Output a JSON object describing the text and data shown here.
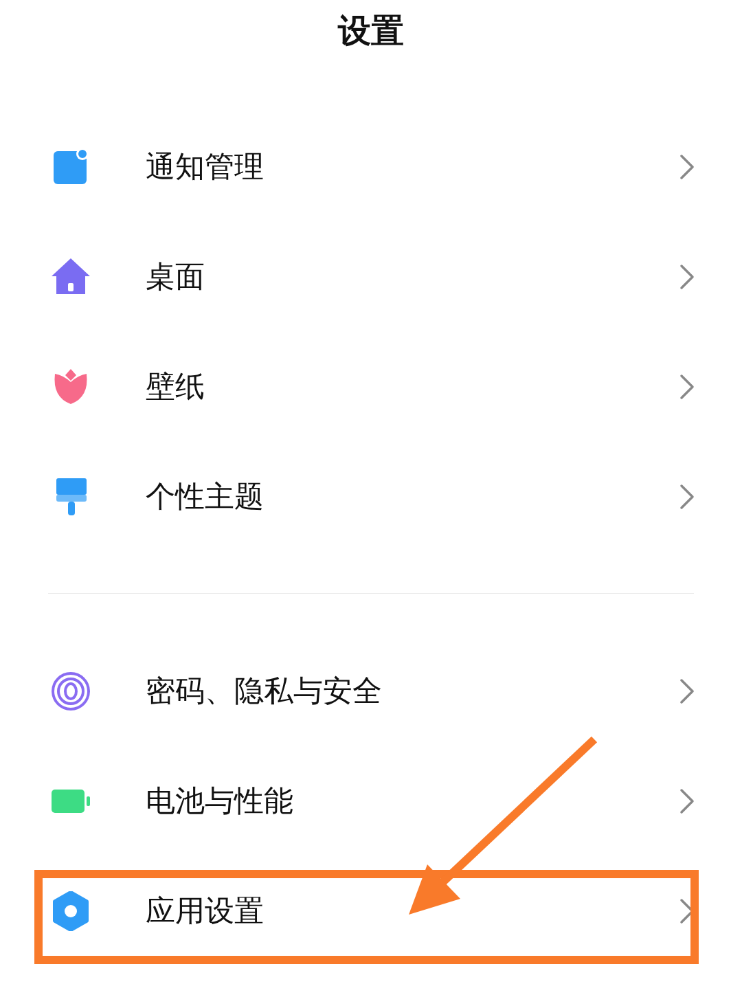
{
  "title": "设置",
  "groups": [
    {
      "items": [
        {
          "kind": "notification",
          "label": "通知管理",
          "highlighted": false
        },
        {
          "kind": "home",
          "label": "桌面",
          "highlighted": false
        },
        {
          "kind": "flower",
          "label": "壁纸",
          "highlighted": false
        },
        {
          "kind": "brush",
          "label": "个性主题",
          "highlighted": false
        }
      ]
    },
    {
      "items": [
        {
          "kind": "fingerprint",
          "label": "密码、隐私与安全",
          "highlighted": false
        },
        {
          "kind": "battery",
          "label": "电池与性能",
          "highlighted": false
        },
        {
          "kind": "gear",
          "label": "应用设置",
          "highlighted": true
        }
      ]
    }
  ]
}
